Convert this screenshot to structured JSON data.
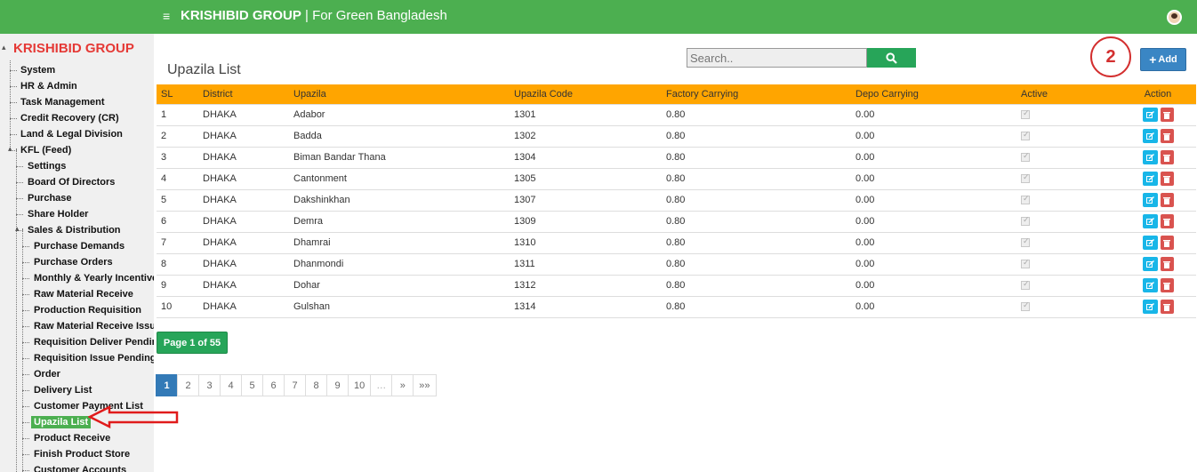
{
  "header": {
    "menu_glyph": "≡",
    "brand_bold": "KRISHIBID GROUP",
    "brand_sep": " | ",
    "brand_tag": "For Green Bangladesh"
  },
  "sidebar": {
    "root": "KRISHIBID GROUP",
    "items": [
      {
        "label": "System"
      },
      {
        "label": "HR & Admin"
      },
      {
        "label": "Task Management"
      },
      {
        "label": "Credit Recovery (CR)"
      },
      {
        "label": "Land & Legal Division"
      },
      {
        "label": "KFL (Feed)"
      },
      {
        "label": "Settings"
      },
      {
        "label": "Board Of Directors"
      },
      {
        "label": "Purchase"
      },
      {
        "label": "Share Holder"
      },
      {
        "label": "Sales & Distribution"
      },
      {
        "label": "Purchase Demands"
      },
      {
        "label": "Purchase Orders"
      },
      {
        "label": "Monthly & Yearly Incentive"
      },
      {
        "label": "Raw Material Receive"
      },
      {
        "label": "Production Requisition"
      },
      {
        "label": "Raw Material Receive Issue"
      },
      {
        "label": "Requisition Deliver Pending"
      },
      {
        "label": "Requisition Issue Pending"
      },
      {
        "label": "Order"
      },
      {
        "label": "Delivery List"
      },
      {
        "label": "Customer Payment List"
      },
      {
        "label": "Upazila List"
      },
      {
        "label": "Product Receive"
      },
      {
        "label": "Finish Product Store"
      },
      {
        "label": "Customer Accounts"
      }
    ]
  },
  "main": {
    "title": "Upazila List",
    "search_placeholder": "Search..",
    "annotation_number": "2",
    "add_label": "Add",
    "columns": [
      "SL",
      "District",
      "Upazila",
      "Upazila Code",
      "Factory Carrying",
      "Depo Carrying",
      "Active",
      "Action"
    ],
    "rows": [
      [
        "1",
        "DHAKA",
        "Adabor",
        "1301",
        "0.80",
        "0.00"
      ],
      [
        "2",
        "DHAKA",
        "Badda",
        "1302",
        "0.80",
        "0.00"
      ],
      [
        "3",
        "DHAKA",
        "Biman Bandar Thana",
        "1304",
        "0.80",
        "0.00"
      ],
      [
        "4",
        "DHAKA",
        "Cantonment",
        "1305",
        "0.80",
        "0.00"
      ],
      [
        "5",
        "DHAKA",
        "Dakshinkhan",
        "1307",
        "0.80",
        "0.00"
      ],
      [
        "6",
        "DHAKA",
        "Demra",
        "1309",
        "0.80",
        "0.00"
      ],
      [
        "7",
        "DHAKA",
        "Dhamrai",
        "1310",
        "0.80",
        "0.00"
      ],
      [
        "8",
        "DHAKA",
        "Dhanmondi",
        "1311",
        "0.80",
        "0.00"
      ],
      [
        "9",
        "DHAKA",
        "Dohar",
        "1312",
        "0.80",
        "0.00"
      ],
      [
        "10",
        "DHAKA",
        "Gulshan",
        "1314",
        "0.80",
        "0.00"
      ]
    ],
    "page_info": "Page 1 of 55",
    "pager": [
      "1",
      "2",
      "3",
      "4",
      "5",
      "6",
      "7",
      "8",
      "9",
      "10",
      "…",
      "»",
      "»»"
    ]
  },
  "colors": {
    "accent": "#4caf50",
    "header_row": "#ffa500",
    "brand_red": "#e53935",
    "primary": "#337ab7"
  },
  "icons": {
    "menu": "hamburger-icon",
    "search": "search-icon",
    "add": "plus-icon",
    "edit": "edit-icon",
    "delete": "trash-icon"
  }
}
